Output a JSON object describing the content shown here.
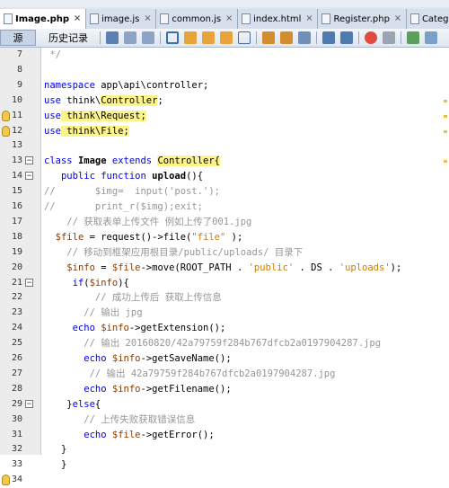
{
  "tabs": [
    {
      "label": "Image.php",
      "active": true
    },
    {
      "label": "image.js",
      "active": false
    },
    {
      "label": "common.js",
      "active": false
    },
    {
      "label": "index.html",
      "active": false
    },
    {
      "label": "Register.php",
      "active": false
    },
    {
      "label": "Categor",
      "active": false
    }
  ],
  "toolbar": {
    "source": "源",
    "history": "历史记录"
  },
  "lines": [
    {
      "n": "7",
      "fold": "",
      "tokens": [
        {
          "t": " */",
          "c": "cm"
        }
      ]
    },
    {
      "n": "8",
      "tokens": []
    },
    {
      "n": "9",
      "tokens": [
        {
          "t": "namespace",
          "c": "kw"
        },
        {
          "t": " app\\api\\controller;"
        }
      ]
    },
    {
      "n": "10",
      "tokens": [
        {
          "t": "use",
          "c": "kw"
        },
        {
          "t": " think\\"
        },
        {
          "t": "Controller",
          "c": "hl"
        },
        {
          "t": ";"
        }
      ]
    },
    {
      "n": "11",
      "bulb": true,
      "tokens": [
        {
          "t": "use",
          "c": "kw"
        },
        {
          "t": " think\\Request;",
          "c": "hl"
        }
      ]
    },
    {
      "n": "12",
      "bulb": true,
      "tokens": [
        {
          "t": "use",
          "c": "kw"
        },
        {
          "t": " think\\File;",
          "c": "hl"
        }
      ]
    },
    {
      "n": "13",
      "tokens": []
    },
    {
      "n": "13",
      "fold": "-",
      "tokens": [
        {
          "t": "class",
          "c": "kw"
        },
        {
          "t": " "
        },
        {
          "t": "Image",
          "c": "bold"
        },
        {
          "t": " "
        },
        {
          "t": "extends",
          "c": "kw"
        },
        {
          "t": " "
        },
        {
          "t": "Controller{",
          "c": "hl"
        }
      ]
    },
    {
      "n": "14",
      "fold": "-",
      "tokens": [
        {
          "t": "   "
        },
        {
          "t": "public function",
          "c": "kw"
        },
        {
          "t": " "
        },
        {
          "t": "upload",
          "c": "bold"
        },
        {
          "t": "(){"
        }
      ]
    },
    {
      "n": "15",
      "tokens": [
        {
          "t": "//       $img=  input('post.');",
          "c": "cm"
        }
      ]
    },
    {
      "n": "16",
      "tokens": [
        {
          "t": "//       print_r($img);exit;",
          "c": "cm"
        }
      ]
    },
    {
      "n": "17",
      "tokens": [
        {
          "t": "    "
        },
        {
          "t": "// 获取表单上传文件 例如上传了001.jpg",
          "c": "cm"
        }
      ]
    },
    {
      "n": "18",
      "tokens": [
        {
          "t": "  "
        },
        {
          "t": "$file",
          "c": "var"
        },
        {
          "t": " = request()->file("
        },
        {
          "t": "\"file\"",
          "c": "str"
        },
        {
          "t": " );"
        }
      ]
    },
    {
      "n": "19",
      "tokens": [
        {
          "t": "    "
        },
        {
          "t": "// 移动到框架应用根目录/public/uploads/ 目录下",
          "c": "cm"
        }
      ]
    },
    {
      "n": "20",
      "tokens": [
        {
          "t": "    "
        },
        {
          "t": "$info",
          "c": "var"
        },
        {
          "t": " = "
        },
        {
          "t": "$file",
          "c": "var"
        },
        {
          "t": "->move(ROOT_PATH . "
        },
        {
          "t": "'public'",
          "c": "str"
        },
        {
          "t": " . DS . "
        },
        {
          "t": "'uploads'",
          "c": "str"
        },
        {
          "t": ");"
        }
      ]
    },
    {
      "n": "21",
      "fold": "-",
      "tokens": [
        {
          "t": "     "
        },
        {
          "t": "if",
          "c": "kw"
        },
        {
          "t": "("
        },
        {
          "t": "$info",
          "c": "var"
        },
        {
          "t": "){"
        }
      ]
    },
    {
      "n": "22",
      "tokens": [
        {
          "t": "         "
        },
        {
          "t": "// 成功上传后 获取上传信息",
          "c": "cm"
        }
      ]
    },
    {
      "n": "23",
      "tokens": [
        {
          "t": "       "
        },
        {
          "t": "// 输出 jpg",
          "c": "cm"
        }
      ]
    },
    {
      "n": "24",
      "tokens": [
        {
          "t": "     "
        },
        {
          "t": "echo",
          "c": "kw"
        },
        {
          "t": " "
        },
        {
          "t": "$info",
          "c": "var"
        },
        {
          "t": "->getExtension();"
        }
      ]
    },
    {
      "n": "25",
      "tokens": [
        {
          "t": "       "
        },
        {
          "t": "// 输出 20160820/42a79759f284b767dfcb2a0197904287.jpg",
          "c": "cm"
        }
      ]
    },
    {
      "n": "26",
      "tokens": [
        {
          "t": "       "
        },
        {
          "t": "echo",
          "c": "kw"
        },
        {
          "t": " "
        },
        {
          "t": "$info",
          "c": "var"
        },
        {
          "t": "->getSaveName();"
        }
      ]
    },
    {
      "n": "27",
      "tokens": [
        {
          "t": "        "
        },
        {
          "t": "// 输出 42a79759f284b767dfcb2a0197904287.jpg",
          "c": "cm"
        }
      ]
    },
    {
      "n": "28",
      "tokens": [
        {
          "t": "       "
        },
        {
          "t": "echo",
          "c": "kw"
        },
        {
          "t": " "
        },
        {
          "t": "$info",
          "c": "var"
        },
        {
          "t": "->getFilename();"
        }
      ]
    },
    {
      "n": "29",
      "fold": "-",
      "tokens": [
        {
          "t": "    }"
        },
        {
          "t": "else",
          "c": "kw"
        },
        {
          "t": "{"
        }
      ]
    },
    {
      "n": "30",
      "tokens": [
        {
          "t": "       "
        },
        {
          "t": "// 上传失败获取错误信息",
          "c": "cm"
        }
      ]
    },
    {
      "n": "31",
      "tokens": [
        {
          "t": "       "
        },
        {
          "t": "echo",
          "c": "kw"
        },
        {
          "t": " "
        },
        {
          "t": "$file",
          "c": "var"
        },
        {
          "t": "->getError();"
        }
      ]
    },
    {
      "n": "32",
      "tokens": [
        {
          "t": "   }"
        }
      ]
    },
    {
      "n": "33",
      "tokens": [
        {
          "t": "   }"
        }
      ]
    },
    {
      "n": "34",
      "bulb": true,
      "tokens": []
    }
  ],
  "colors": {
    "keyword": "#0000e6",
    "comment": "#969696",
    "string": "#ce7b00",
    "variable": "#8a3b00",
    "highlight": "#fdf58a"
  }
}
